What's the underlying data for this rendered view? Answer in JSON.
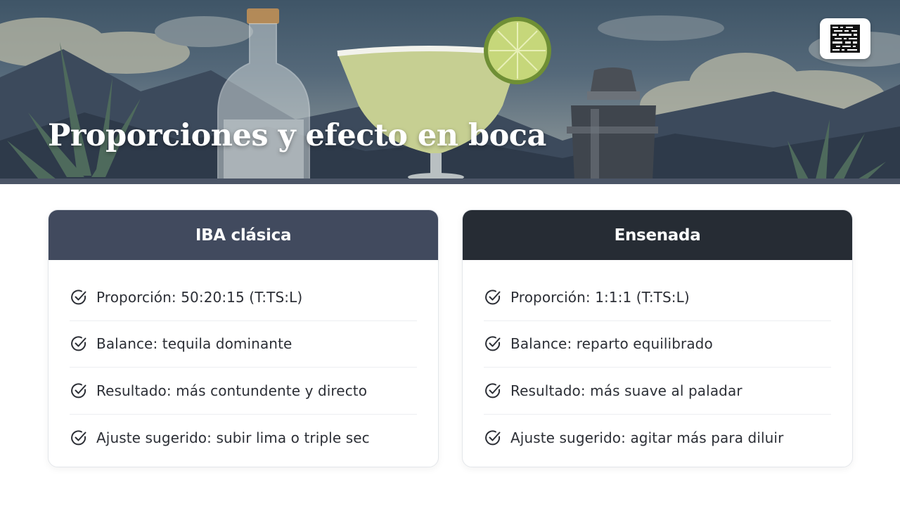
{
  "header": {
    "title": "Proporciones y efecto en boca",
    "logo_icon": "qr-code-logo-icon"
  },
  "colors": {
    "left_header": "#414a5e",
    "right_header": "#262c34",
    "text": "#2c2f36"
  },
  "cards": [
    {
      "title": "IBA clásica",
      "items": [
        {
          "icon": "check-circle-icon",
          "text": "Proporción: 50:20:15 (T:TS:L)"
        },
        {
          "icon": "check-circle-icon",
          "text": "Balance: tequila dominante"
        },
        {
          "icon": "check-circle-icon",
          "text": "Resultado: más contundente y directo"
        },
        {
          "icon": "check-circle-icon",
          "text": "Ajuste sugerido: subir lima o triple sec"
        }
      ]
    },
    {
      "title": "Ensenada",
      "items": [
        {
          "icon": "check-circle-icon",
          "text": "Proporción: 1:1:1 (T:TS:L)"
        },
        {
          "icon": "check-circle-icon",
          "text": "Balance: reparto equilibrado"
        },
        {
          "icon": "check-circle-icon",
          "text": "Resultado: más suave al paladar"
        },
        {
          "icon": "check-circle-icon",
          "text": "Ajuste sugerido: agitar más para diluir"
        }
      ]
    }
  ]
}
